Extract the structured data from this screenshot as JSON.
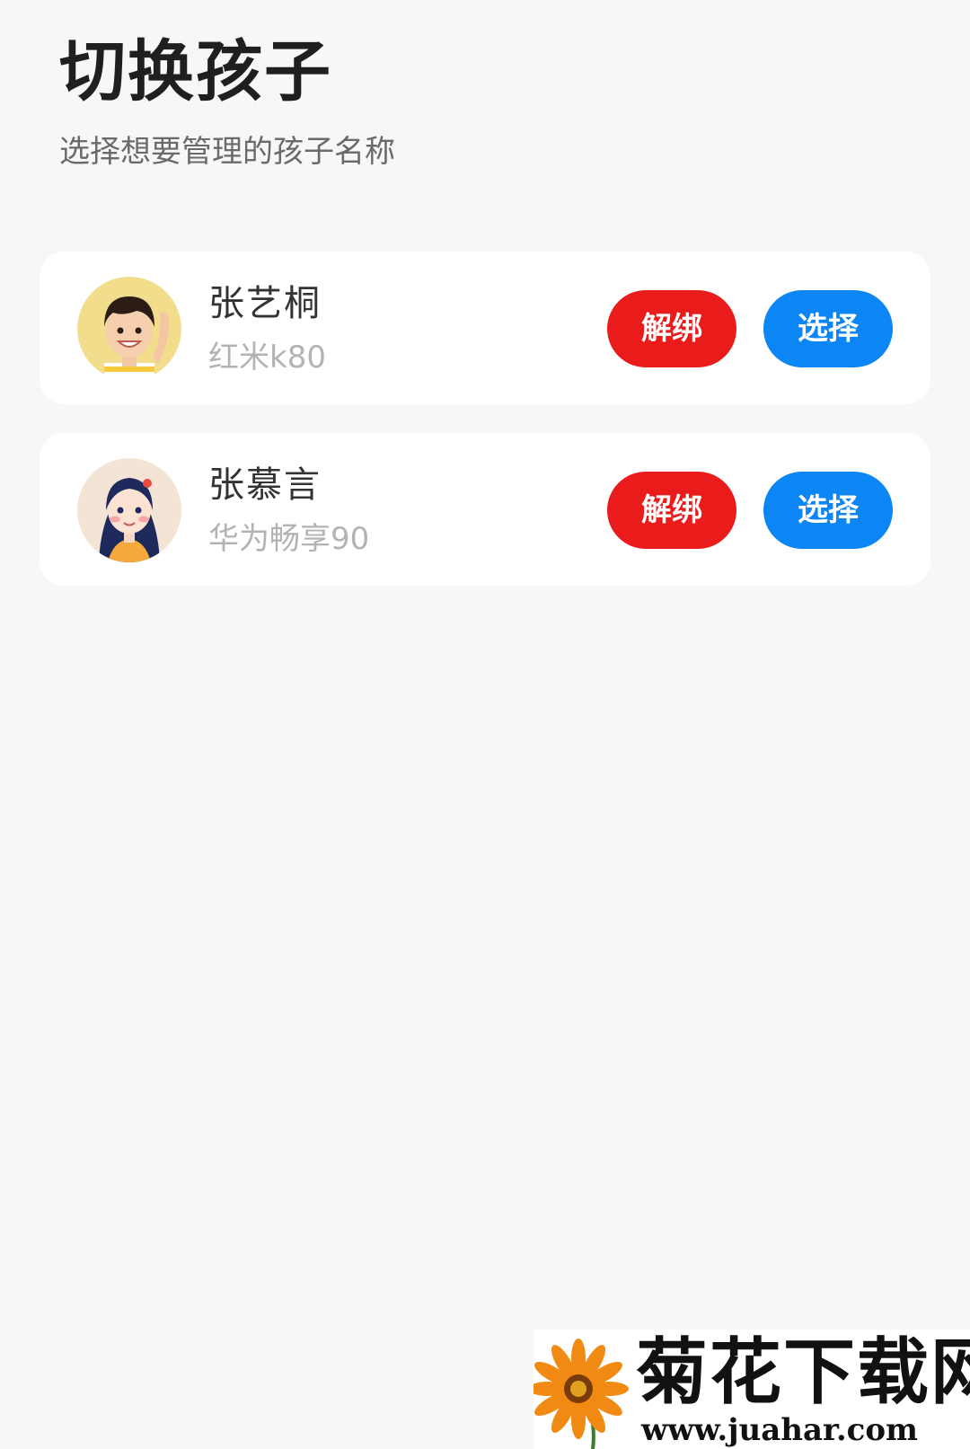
{
  "header": {
    "title": "切换孩子",
    "subtitle": "选择想要管理的孩子名称"
  },
  "children": [
    {
      "name": "张艺桐",
      "device": "红米k80",
      "avatar": "boy-avatar-icon",
      "unbind_label": "解绑",
      "select_label": "选择"
    },
    {
      "name": "张慕言",
      "device": "华为畅享90",
      "avatar": "girl-avatar-icon",
      "unbind_label": "解绑",
      "select_label": "选择"
    }
  ],
  "watermark": {
    "title": "菊花下载网",
    "url": "www.juahar.com"
  },
  "colors": {
    "background": "#f7f7f7",
    "card": "#ffffff",
    "unbind": "#e91b1b",
    "select": "#0d86f5"
  }
}
